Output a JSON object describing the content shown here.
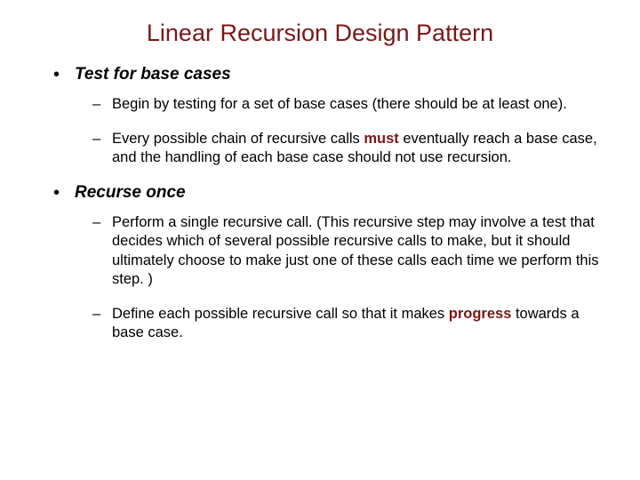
{
  "title": "Linear Recursion Design Pattern",
  "sections": [
    {
      "heading": "Test for base cases",
      "items": [
        {
          "pre": "Begin by testing for a set of base cases (there should be at least one).",
          "kw": "",
          "post": ""
        },
        {
          "pre": "Every possible chain of recursive calls ",
          "kw": "must",
          "post": " eventually reach a base case, and the handling of each base case should not use recursion."
        }
      ]
    },
    {
      "heading": "Recurse once",
      "items": [
        {
          "pre": "Perform a single recursive call. (This recursive step may involve a test that decides which of several possible recursive calls to make, but it should ultimately choose to make just one of these calls each time we perform this step. )",
          "kw": "",
          "post": ""
        },
        {
          "pre": "Define each possible recursive call so that it makes ",
          "kw": "progress",
          "post": " towards a base case."
        }
      ]
    }
  ]
}
